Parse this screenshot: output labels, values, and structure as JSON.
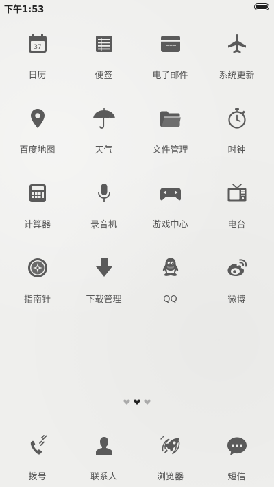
{
  "status_bar": {
    "time": "下午1:53"
  },
  "apps": [
    {
      "label": "日历",
      "icon": "calendar-icon",
      "badge": "37"
    },
    {
      "label": "便签",
      "icon": "notes-icon"
    },
    {
      "label": "电子邮件",
      "icon": "email-icon"
    },
    {
      "label": "系统更新",
      "icon": "airplane-icon"
    },
    {
      "label": "百度地图",
      "icon": "map-pin-icon"
    },
    {
      "label": "天气",
      "icon": "umbrella-icon"
    },
    {
      "label": "文件管理",
      "icon": "folder-icon"
    },
    {
      "label": "时钟",
      "icon": "stopwatch-icon"
    },
    {
      "label": "计算器",
      "icon": "calculator-icon"
    },
    {
      "label": "录音机",
      "icon": "microphone-icon"
    },
    {
      "label": "游戏中心",
      "icon": "gamepad-icon"
    },
    {
      "label": "电台",
      "icon": "radio-icon"
    },
    {
      "label": "指南针",
      "icon": "compass-icon"
    },
    {
      "label": "下载管理",
      "icon": "download-icon"
    },
    {
      "label": "QQ",
      "icon": "qq-icon"
    },
    {
      "label": "微博",
      "icon": "weibo-icon"
    }
  ],
  "pages": {
    "count": 3,
    "active": 1
  },
  "dock": [
    {
      "label": "拨号",
      "icon": "phone-icon"
    },
    {
      "label": "联系人",
      "icon": "contacts-icon"
    },
    {
      "label": "浏览器",
      "icon": "rocket-browser-icon"
    },
    {
      "label": "短信",
      "icon": "message-icon"
    }
  ],
  "colors": {
    "icon": "#5a5a5a",
    "label": "#555555",
    "background": "#efefed",
    "active_dot": "#222222",
    "inactive_dot": "#aaaaaa"
  }
}
